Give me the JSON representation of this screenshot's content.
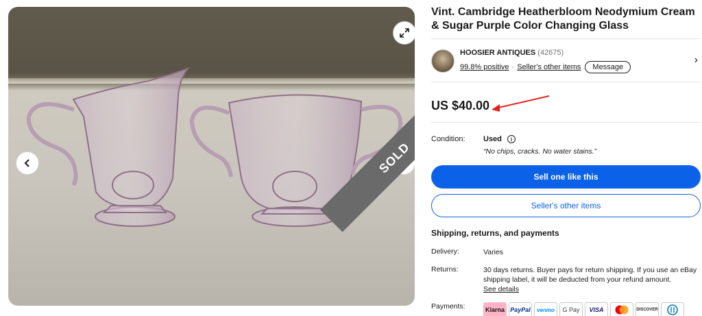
{
  "listing": {
    "title": "Vint. Cambridge Heatherbloom Neodymium Cream & Sugar Purple Color Changing Glass"
  },
  "gallery": {
    "expand_icon": "expand-icon",
    "prev_icon": "chevron-left-icon",
    "next_icon": "chevron-right-icon",
    "ribbon": "SOLD"
  },
  "seller": {
    "name": "HOOSIER ANTIQUES",
    "feedback_count": "(42675)",
    "positive": "99.8% positive",
    "separator": "·",
    "other_items_link": "Seller's other items",
    "message_button": "Message",
    "chevron": "›"
  },
  "price": {
    "text": "US $40.00",
    "annotation_color": "#e0201f"
  },
  "condition": {
    "label": "Condition:",
    "value": "Used",
    "info_glyph": "i",
    "quote": "“No chips, cracks. No water stains.”"
  },
  "actions": {
    "primary": "Sell one like this",
    "secondary": "Seller's other items",
    "primary_color": "#0b62e8"
  },
  "shipping": {
    "heading": "Shipping, returns, and payments",
    "delivery_label": "Delivery:",
    "delivery_value": "Varies",
    "returns_label": "Returns:",
    "returns_value": "30 days returns. Buyer pays for return shipping. If you use an eBay shipping label, it will be deducted from your refund amount.",
    "returns_link": "See details",
    "payments_label": "Payments:",
    "payments": [
      "Klarna",
      "PayPal",
      "venmo",
      "G Pay",
      "VISA",
      "mastercard",
      "DISCOVER",
      "Diners Club"
    ]
  }
}
